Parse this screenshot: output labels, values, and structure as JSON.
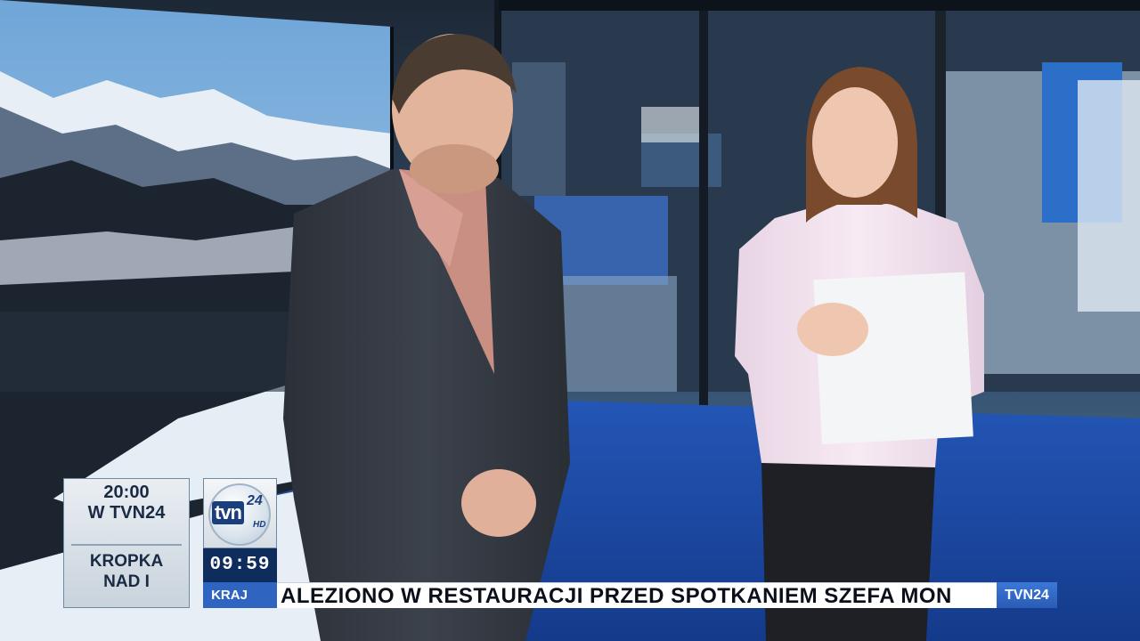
{
  "program_box": {
    "time": "20:00",
    "channel": "W TVN24",
    "show_line1": "KROPKA",
    "show_line2": "NAD I"
  },
  "logo": {
    "word": "tvn",
    "number": "24",
    "hd": "HD"
  },
  "clock": "09:59",
  "section_label": "KRAJ",
  "ticker": {
    "text": "ALEZIONO W RESTAURACJI PRZED SPOTKANIEM SZEFA MON",
    "brand": "TVN24"
  },
  "colors": {
    "clock_bg": "#0e2c5c",
    "section_bg": "#2f64c0",
    "floor": "#1a4aa8"
  }
}
